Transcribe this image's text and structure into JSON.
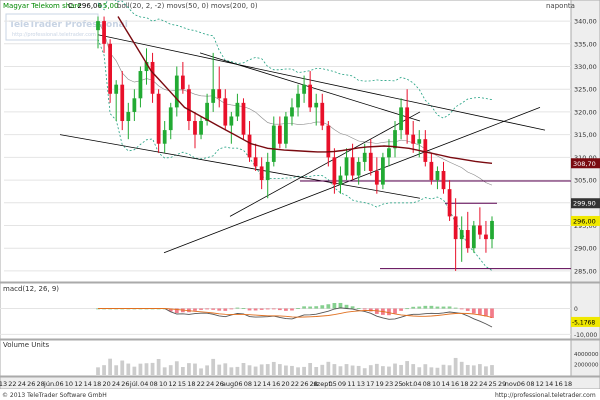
{
  "header": {
    "instrument": "Magyar Telekom share",
    "last_label": "C: 296,00",
    "change": "+5,00",
    "indicators": "boll(20, 2, -2)  movs(50, 0)  movs(200, 0)",
    "period": "naponta"
  },
  "logo": {
    "brand": "TeleTrader Professional",
    "url": "http://professional.teletrader.com"
  },
  "macd_panel": {
    "label": "macd(12, 26, 9)"
  },
  "volume_panel": {
    "label": "Volume Units"
  },
  "footer": {
    "copyright": "© 2013 TeleTrader Software GmbH",
    "url": "http://professional.teletrader.com"
  },
  "colors": {
    "up": "#22aa33",
    "down": "#e8102a",
    "ma50": "#7a0a10",
    "ma200": "#777777",
    "boll": "#20a080",
    "trend": "#000000",
    "support": "#5a0050",
    "macd_line": "#555555",
    "macd_signal": "#e07020",
    "axis_bg": "#eeeeee",
    "header_bg": "#ffffff"
  },
  "chart_data": [
    {
      "type": "candlestick",
      "title": "Magyar Telekom share",
      "ylim": [
        283,
        342
      ],
      "yticks": [
        285,
        290,
        295,
        300,
        305,
        310,
        315,
        320,
        325,
        330,
        335,
        340
      ],
      "ytick_labels": [
        "285,00",
        "290,00",
        "295,00",
        "300,00",
        "305,00",
        "310,00",
        "315,00",
        "320,00",
        "325,00",
        "330,00",
        "335,00",
        "340,00"
      ],
      "price_tags": [
        {
          "value": 308.7,
          "label": "308,70",
          "color": "#7a0a10"
        },
        {
          "value": 299.9,
          "label": "299,90",
          "color": "#333333"
        },
        {
          "value": 296.0,
          "label": "296,00",
          "color": "#f0e800"
        }
      ],
      "x_labels": [
        "13",
        "22",
        "24",
        "26",
        "28",
        "jún.",
        "06",
        "10",
        "12",
        "14",
        "18",
        "20",
        "24",
        "26",
        "júl.",
        "04",
        "08",
        "10",
        "12",
        "15",
        "18",
        "22",
        "24",
        "26",
        "aug.",
        "06",
        "08",
        "12",
        "14",
        "16",
        "20",
        "22",
        "26",
        "28",
        "szept.",
        "05",
        "09",
        "11",
        "13",
        "17",
        "19",
        "23",
        "25",
        "okt.",
        "04",
        "08",
        "10",
        "14",
        "16",
        "18",
        "22",
        "24",
        "25",
        "29",
        "nov.",
        "06",
        "08",
        "12",
        "14",
        "16",
        "18"
      ],
      "candles": [
        [
          338,
          341,
          334,
          340
        ],
        [
          340,
          341,
          333,
          335
        ],
        [
          335,
          336,
          322,
          324
        ],
        [
          324,
          327,
          318,
          326
        ],
        [
          326,
          329,
          316,
          318
        ],
        [
          318,
          322,
          314,
          320
        ],
        [
          320,
          325,
          318,
          323
        ],
        [
          323,
          330,
          321,
          329
        ],
        [
          329,
          334,
          326,
          331
        ],
        [
          331,
          333,
          322,
          324
        ],
        [
          324,
          325,
          311,
          313
        ],
        [
          313,
          318,
          311,
          316
        ],
        [
          316,
          322,
          314,
          321
        ],
        [
          321,
          330,
          319,
          328
        ],
        [
          328,
          331,
          324,
          325
        ],
        [
          325,
          326,
          316,
          318
        ],
        [
          318,
          320,
          312,
          315
        ],
        [
          315,
          319,
          314,
          318
        ],
        [
          318,
          324,
          317,
          322
        ],
        [
          322,
          333,
          320,
          325
        ],
        [
          325,
          330,
          321,
          323
        ],
        [
          323,
          325,
          316,
          317
        ],
        [
          317,
          320,
          313,
          319
        ],
        [
          319,
          324,
          318,
          322
        ],
        [
          322,
          323,
          314,
          315
        ],
        [
          315,
          318,
          309,
          310
        ],
        [
          310,
          313,
          307,
          308
        ],
        [
          308,
          310,
          303,
          305
        ],
        [
          305,
          311,
          301,
          309
        ],
        [
          309,
          319,
          308,
          317
        ],
        [
          317,
          319,
          312,
          313
        ],
        [
          313,
          320,
          312,
          319
        ],
        [
          319,
          323,
          317,
          321
        ],
        [
          321,
          326,
          319,
          324
        ],
        [
          324,
          328,
          322,
          326
        ],
        [
          326,
          329,
          320,
          321
        ],
        [
          321,
          324,
          317,
          322
        ],
        [
          322,
          324,
          316,
          317
        ],
        [
          317,
          318,
          308,
          310
        ],
        [
          310,
          312,
          302,
          304
        ],
        [
          304,
          308,
          302,
          306
        ],
        [
          306,
          312,
          305,
          310
        ],
        [
          310,
          313,
          305,
          306
        ],
        [
          306,
          310,
          304,
          309
        ],
        [
          309,
          313,
          307,
          311
        ],
        [
          311,
          314,
          306,
          307
        ],
        [
          307,
          310,
          302,
          304
        ],
        [
          304,
          311,
          303,
          310
        ],
        [
          310,
          314,
          308,
          312
        ],
        [
          312,
          318,
          310,
          316
        ],
        [
          316,
          323,
          314,
          321
        ],
        [
          321,
          325,
          313,
          315
        ],
        [
          315,
          318,
          311,
          313
        ],
        [
          313,
          316,
          310,
          314
        ],
        [
          314,
          316,
          308,
          309
        ],
        [
          309,
          311,
          304,
          305
        ],
        [
          305,
          308,
          303,
          307
        ],
        [
          307,
          309,
          302,
          303
        ],
        [
          303,
          305,
          296,
          297
        ],
        [
          297,
          301,
          285,
          292
        ],
        [
          292,
          297,
          287,
          294
        ],
        [
          294,
          298,
          289,
          290
        ],
        [
          290,
          296,
          289,
          295
        ],
        [
          295,
          299,
          292,
          293
        ],
        [
          293,
          296,
          289,
          292
        ],
        [
          292,
          297,
          290,
          296
        ]
      ],
      "ma50": [
        341,
        338,
        335,
        332,
        329,
        327,
        325,
        323,
        321,
        320,
        319,
        318,
        317,
        316,
        315,
        314,
        313,
        312.5,
        312,
        311.8,
        311.6,
        311.5,
        311.4,
        311.3,
        311.2,
        311.2,
        311.3,
        311.5,
        311.8,
        312.1,
        312.3,
        312.4,
        312.5,
        312.4,
        312.2,
        312,
        311.6,
        311.2,
        310.8,
        310.4,
        310,
        309.7,
        309.4,
        309.1,
        308.9,
        308.7
      ],
      "ma200_note": "long-term average line (grey, partly visible)",
      "boll_note": "Bollinger bands (dashed green)"
    },
    {
      "type": "line",
      "title": "macd(12, 26, 9)",
      "ylim": [
        -11,
        6
      ],
      "yticks": [
        -10,
        0
      ],
      "ytick_labels": [
        "-10,000",
        "0"
      ],
      "last_value_label": "-5,1768",
      "series_names": [
        "macd",
        "signal",
        "histogram"
      ]
    },
    {
      "type": "bar",
      "title": "Volume Units",
      "ylim": [
        0,
        5000000
      ],
      "yticks": [
        0,
        2000000,
        4000000
      ],
      "ytick_labels": [
        "",
        "2000000",
        "4000000"
      ]
    }
  ]
}
